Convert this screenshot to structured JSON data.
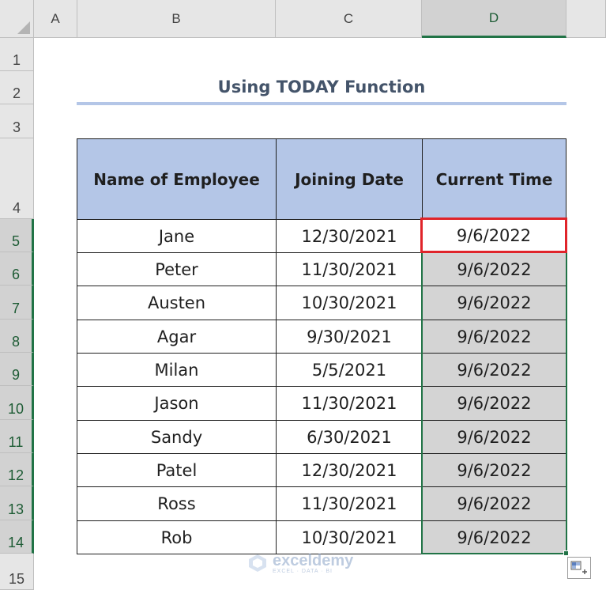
{
  "columns": [
    "A",
    "B",
    "C",
    "D"
  ],
  "rows": [
    "1",
    "2",
    "3",
    "4",
    "5",
    "6",
    "7",
    "8",
    "9",
    "10",
    "11",
    "12",
    "13",
    "14",
    "15"
  ],
  "title": "Using TODAY Function",
  "table": {
    "headers": [
      "Name of Employee",
      "Joining Date",
      "Current Time"
    ],
    "rows": [
      [
        "Jane",
        "12/30/2021",
        "9/6/2022"
      ],
      [
        "Peter",
        "11/30/2021",
        "9/6/2022"
      ],
      [
        "Austen",
        "10/30/2021",
        "9/6/2022"
      ],
      [
        "Agar",
        "9/30/2021",
        "9/6/2022"
      ],
      [
        "Milan",
        "5/5/2021",
        "9/6/2022"
      ],
      [
        "Jason",
        "11/30/2021",
        "9/6/2022"
      ],
      [
        "Sandy",
        "6/30/2021",
        "9/6/2022"
      ],
      [
        "Patel",
        "12/30/2021",
        "9/6/2022"
      ],
      [
        "Ross",
        "11/30/2021",
        "9/6/2022"
      ],
      [
        "Rob",
        "10/30/2021",
        "9/6/2022"
      ]
    ]
  },
  "watermark": {
    "brand": "exceldemy",
    "tagline": "EXCEL · DATA · BI"
  },
  "colors": {
    "header_fill": "#b4c6e7",
    "selection_green": "#217346",
    "active_cell_red": "#e0242a",
    "title_text": "#44546a"
  },
  "icons": {
    "quick_analysis": "quick-analysis-icon",
    "watermark_logo": "exceldemy-logo-icon"
  }
}
